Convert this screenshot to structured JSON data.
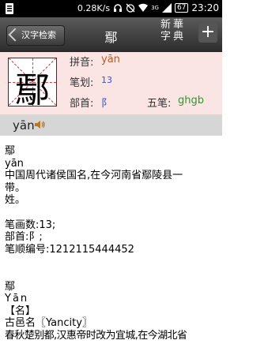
{
  "status_bar": {
    "network_speed": "0.28K/s",
    "network_type": "3G",
    "battery": "67",
    "time": "23:20"
  },
  "title_bar": {
    "back_label": "汉字检索",
    "title": "鄢",
    "logo_line1": "新華",
    "logo_line2": "字典",
    "plus_label": "+"
  },
  "header": {
    "character": "鄢",
    "pinyin_label": "拼音:",
    "pinyin_value": "yān",
    "strokes_label": "笔划:",
    "strokes_value": "13",
    "radical_label": "部首:",
    "radical_value": "阝",
    "wubi_label": "五笔:",
    "wubi_value": "ghgb",
    "colors": {
      "pinyin": "#c05a1a",
      "strokes": "#3355cc",
      "radical": "#3355cc",
      "wubi": "#2a9a2a",
      "panel_bg": "#fbe4e4"
    }
  },
  "pronunciation": {
    "text": "yān",
    "speaker_icon": "speaker-icon"
  },
  "definition": {
    "lines": [
      "鄢",
      "yān",
      "中国周代诸侯国名,在今河南省鄢陵县一",
      "带。",
      "姓。",
      "",
      "笔画数:13;",
      "部首:阝;",
      "笔顺编号:1212115444452",
      "",
      "",
      "鄢",
      "Yān",
      "【名】",
      "古邑名〖Yancity〗",
      "春秋楚别都,汉惠帝时改为宜城,在今湖北省"
    ]
  }
}
